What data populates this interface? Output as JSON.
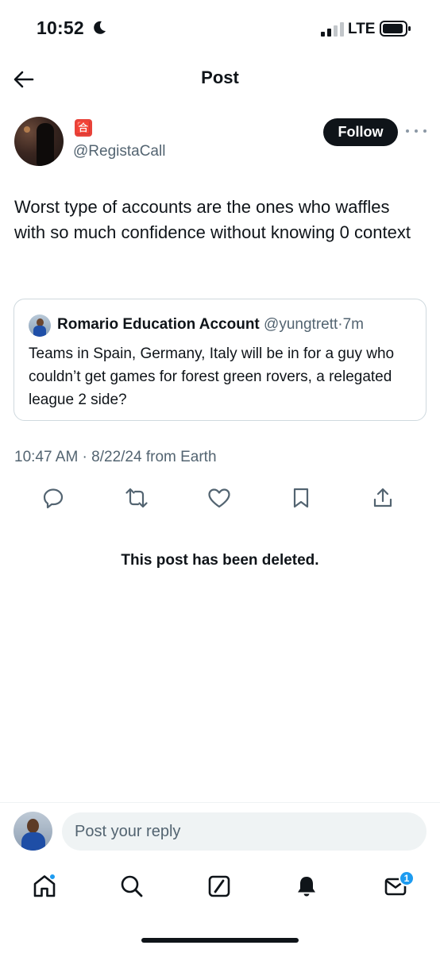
{
  "status_bar": {
    "time": "10:52",
    "network": "LTE"
  },
  "header": {
    "title": "Post"
  },
  "post": {
    "author_emoji": "🈴",
    "author_handle": "@RegistaCall",
    "follow_label": "Follow",
    "text": "Worst type of accounts are the ones who waffles with so much confidence without knowing 0 context",
    "timestamp": "10:47 AM · 8/22/24 from Earth"
  },
  "quote": {
    "name": "Romario Education Account",
    "handle": "@yungtrett",
    "separator": "·",
    "time": "7m",
    "text": "Teams in Spain, Germany, Italy will be in for a guy who couldn’t get games for forest green rovers, a relegated league 2 side?"
  },
  "actions": [
    "reply-icon",
    "repost-icon",
    "like-icon",
    "bookmark-icon",
    "share-icon"
  ],
  "deleted_notice": "This post has been deleted.",
  "reply": {
    "placeholder": "Post your reply"
  },
  "bottom_nav": {
    "messages_badge": "1"
  },
  "colors": {
    "text_primary": "#0f1419",
    "text_secondary": "#536471",
    "accent": "#1d9bf0",
    "border": "#cfd9de"
  }
}
